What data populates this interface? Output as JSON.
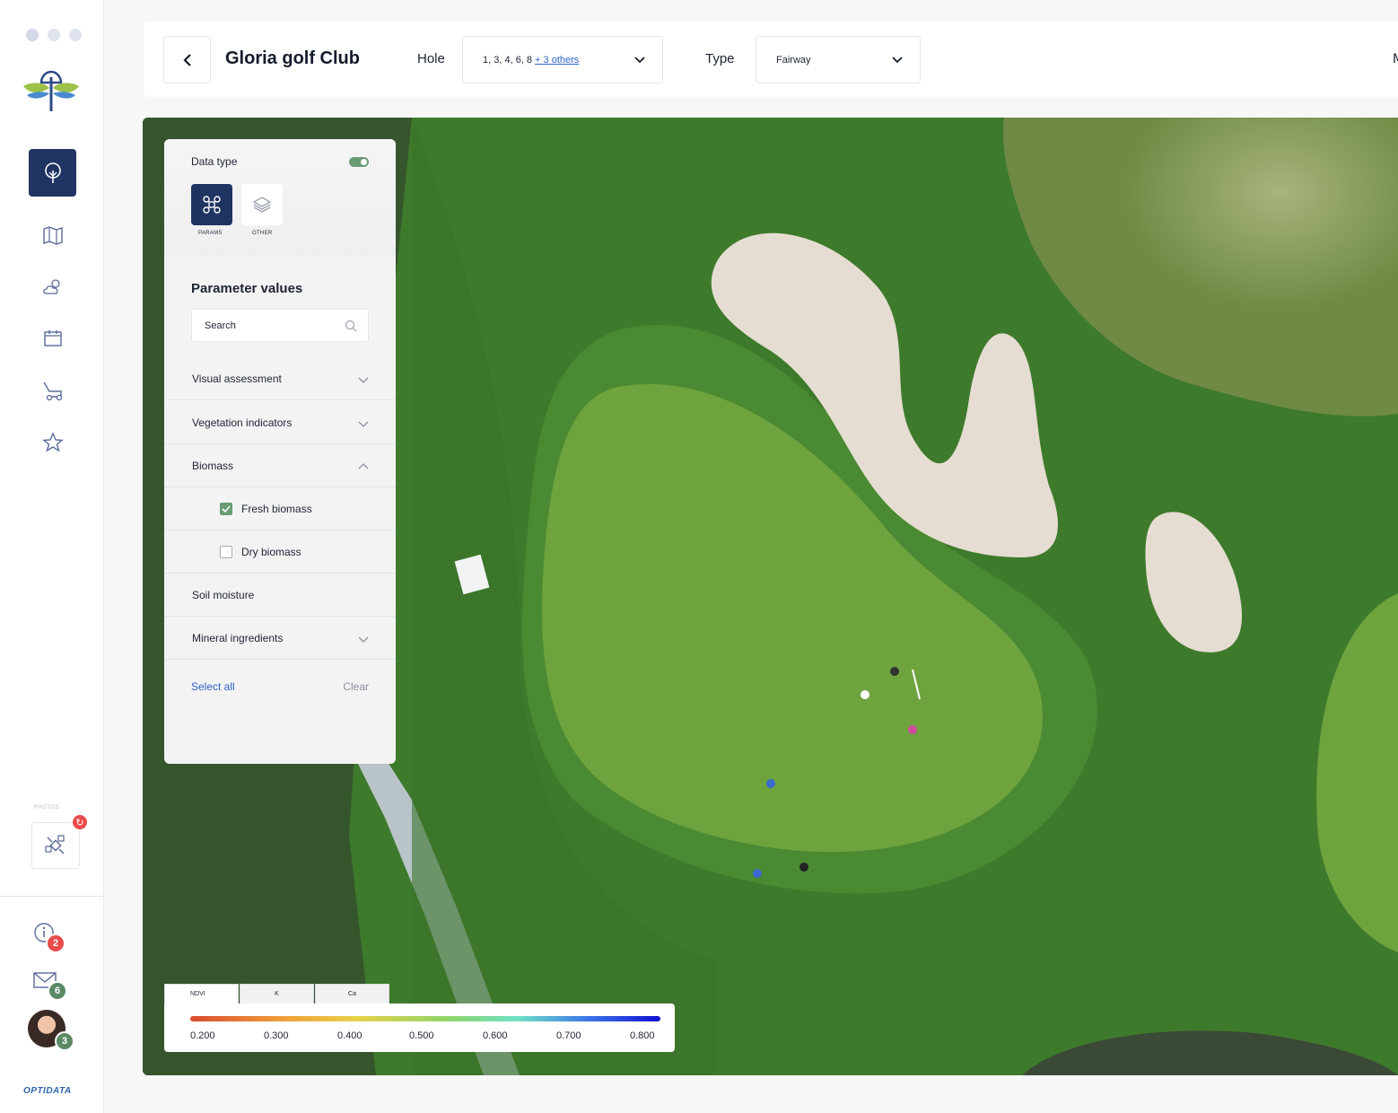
{
  "header": {
    "title": "Gloria golf Club",
    "hole_label": "Hole",
    "hole_value": "1, 3, 4, 6, 8",
    "hole_more": "+ 3 others",
    "type_label": "Type",
    "type_value": "Fairway",
    "cut_text": "M"
  },
  "sidebar": {
    "photos_label": "PHOTOS",
    "info_count": "2",
    "mail_count": "6",
    "avatar_count": "3",
    "brand": "OPTIDATA"
  },
  "panel": {
    "data_type_label": "Data type",
    "params_caption": "PARAMS",
    "other_caption": "OTHER",
    "param_values_title": "Parameter values",
    "search_placeholder": "Search",
    "rows": [
      {
        "label": "Visual assessment"
      },
      {
        "label": "Vegetation indicators"
      },
      {
        "label": "Biomass"
      },
      {
        "label": "Fresh biomass"
      },
      {
        "label": "Dry biomass"
      },
      {
        "label": "Soil moisture"
      },
      {
        "label": "Mineral ingredients"
      }
    ],
    "select_all": "Select all",
    "clear": "Clear"
  },
  "legend": {
    "tabs": [
      "NDVI",
      "K",
      "Ca"
    ],
    "values": [
      "0.200",
      "0.300",
      "0.400",
      "0.500",
      "0.600",
      "0.700",
      "0.800"
    ],
    "colors": [
      "#d94a2f",
      "#f0a03a",
      "#e8d24a",
      "#8fd46a",
      "#6fe0c8",
      "#3a72e8",
      "#1010d0"
    ]
  },
  "colors": {
    "accent": "#1f3461",
    "green": "#6a9c73",
    "link": "#2f64c8",
    "alert": "#e94b4b"
  }
}
